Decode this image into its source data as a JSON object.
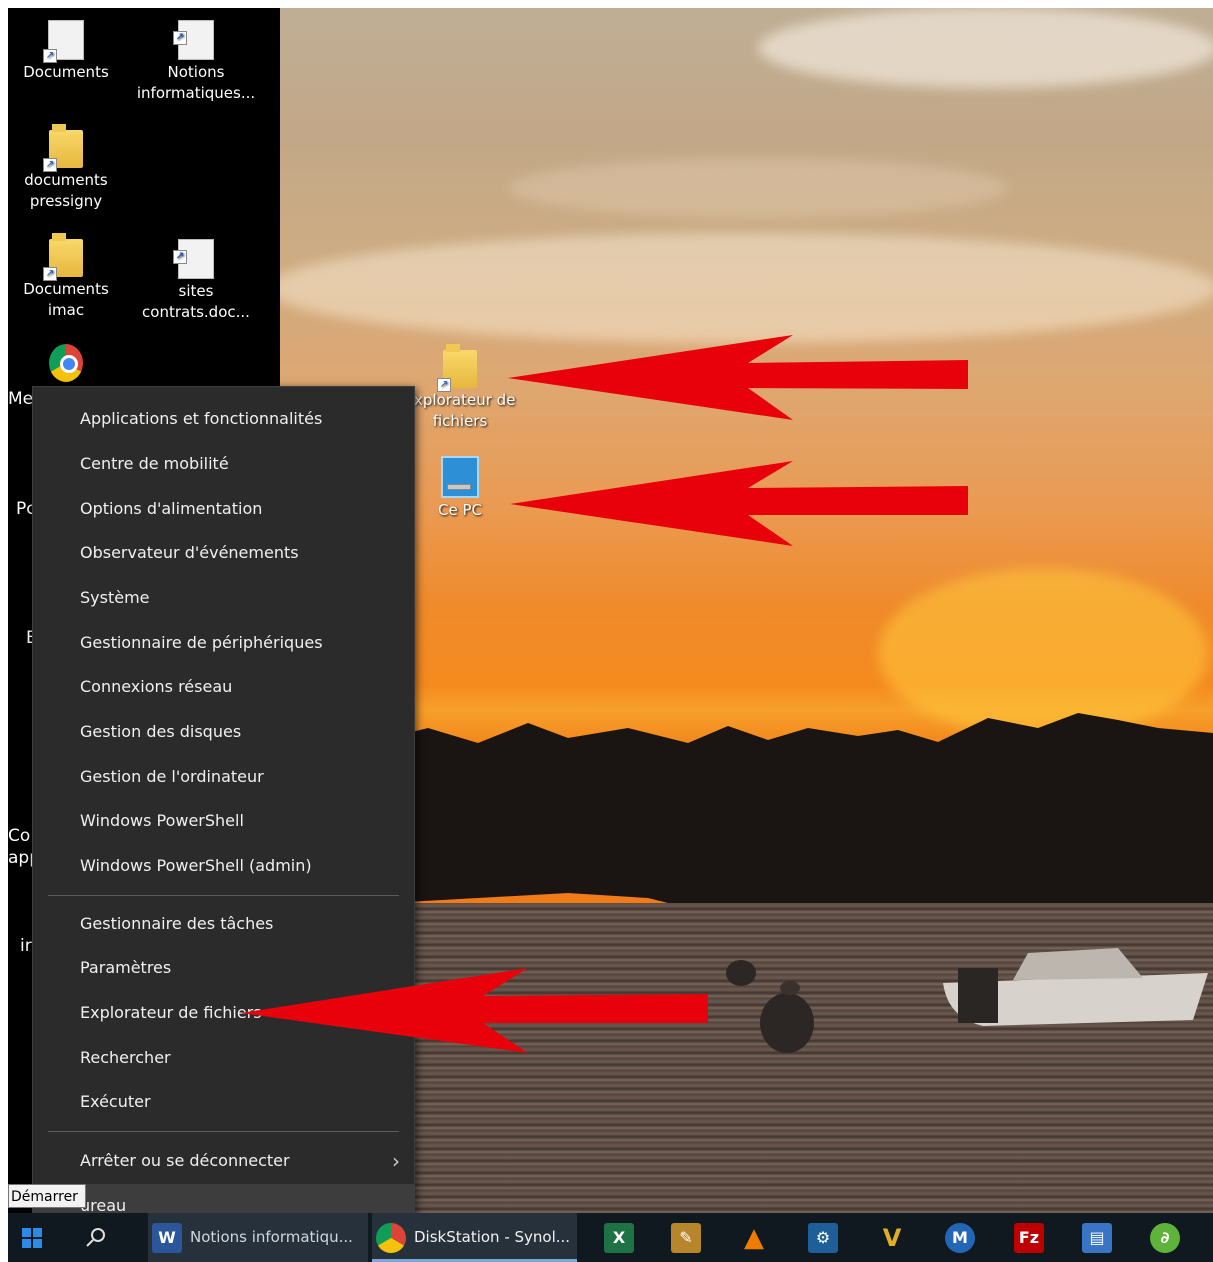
{
  "desktop": {
    "icons": [
      {
        "label": "Documents",
        "icon": "doc-icon"
      },
      {
        "label": "Notions informatiques...",
        "icon": "word-doc-icon"
      },
      {
        "label": "documents pressigny",
        "icon": "folder-icon"
      },
      {
        "label": "Documents imac",
        "icon": "folder-icon"
      },
      {
        "label": "sites contrats.doc...",
        "icon": "word-doc-icon"
      },
      {
        "label": "Explorateur de fichiers",
        "icon": "file-explorer-icon"
      },
      {
        "label": "Ce PC",
        "icon": "this-pc-icon"
      }
    ],
    "left_fragments": [
      "Me",
      "Pc",
      "E",
      "Co",
      "app",
      "ir"
    ]
  },
  "context_menu": {
    "group1": [
      "Applications et fonctionnalités",
      "Centre de mobilité",
      "Options d'alimentation",
      "Observateur d'événements",
      "Système",
      "Gestionnaire de périphériques",
      "Connexions réseau",
      "Gestion des disques",
      "Gestion de l'ordinateur",
      "Windows PowerShell",
      "Windows PowerShell (admin)"
    ],
    "group2": [
      "Gestionnaire des tâches",
      "Paramètres",
      "Explorateur de fichiers",
      "Rechercher",
      "Exécuter"
    ],
    "group3": [
      {
        "label": "Arrêter ou se déconnecter",
        "has_submenu": true
      },
      {
        "label": "ureau"
      }
    ]
  },
  "tooltip": "Démarrer",
  "taskbar": {
    "start_icon": "windows-start-icon",
    "search_icon": "search-icon",
    "apps": [
      {
        "label": "Notions informatiqu...",
        "icon": "word-icon"
      },
      {
        "label": "DiskStation - Synol...",
        "icon": "chrome-icon"
      }
    ],
    "pinned": [
      {
        "glyph": "X",
        "icon": "excel-icon",
        "color": "#1f7244"
      },
      {
        "glyph": "✎",
        "icon": "quill-icon",
        "color": "#b7862a"
      },
      {
        "glyph": "▲",
        "icon": "vlc-icon",
        "color": "#ef7c00"
      },
      {
        "glyph": "⚙",
        "icon": "settings-gear-icon",
        "color": "#1f5f99"
      },
      {
        "glyph": "V",
        "icon": "v-app-icon",
        "color": "#e0b020"
      },
      {
        "glyph": "M",
        "icon": "m-app-icon",
        "color": "#2466b6"
      },
      {
        "glyph": "Fz",
        "icon": "filezilla-icon",
        "color": "#bf0000"
      },
      {
        "glyph": "▤",
        "icon": "pdf-tool-icon",
        "color": "#3a74c4"
      },
      {
        "glyph": "∂",
        "icon": "green-app-icon",
        "color": "#60b33a"
      }
    ]
  },
  "annotations": {
    "arrow_color": "#e8000b"
  }
}
